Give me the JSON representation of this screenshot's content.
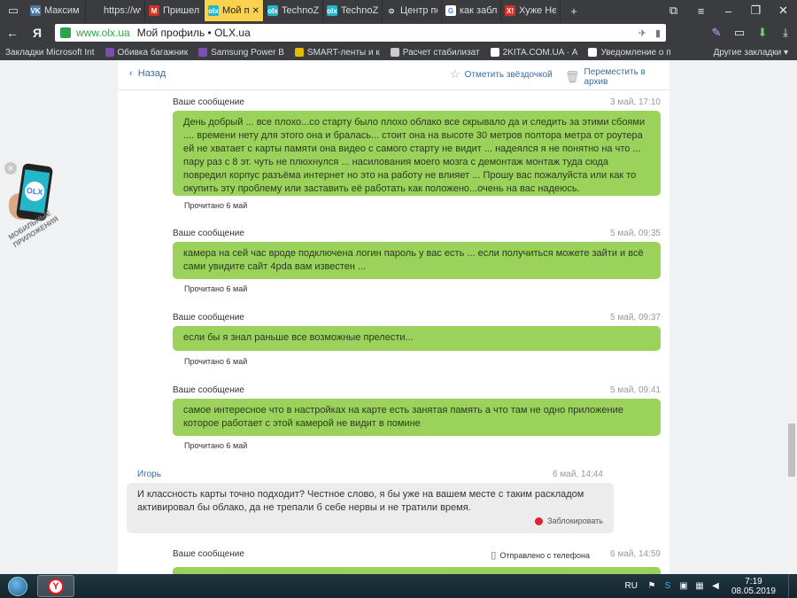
{
  "browser": {
    "tabs": [
      {
        "label": "Максим И",
        "color": "#4a76a8",
        "glyph": "VK"
      },
      {
        "label": "https://ww",
        "color": "",
        "glyph": ""
      },
      {
        "label": "Пришел х",
        "color": "#d93025",
        "glyph": "M"
      },
      {
        "label": "Мой пр",
        "color": "#23b7c9",
        "glyph": "olx",
        "active": true
      },
      {
        "label": "TechnoZo",
        "color": "#23b7c9",
        "glyph": "olx"
      },
      {
        "label": "TechnoZo",
        "color": "#23b7c9",
        "glyph": "olx"
      },
      {
        "label": "Центр пол",
        "color": "",
        "glyph": "⊙"
      },
      {
        "label": "как забло",
        "color": "#ffffff",
        "glyph": "G"
      },
      {
        "label": "Хуже Нет",
        "color": "#d93025",
        "glyph": "X!"
      }
    ],
    "address": {
      "domain": "www.olx.ua",
      "title": "Мой профиль • OLX.ua"
    },
    "bookmarks": [
      {
        "label": "Закладки Microsoft Int",
        "color": ""
      },
      {
        "label": "Обивка багажник",
        "color": "#7b4fb0"
      },
      {
        "label": "Samsung Power B",
        "color": "#7b4fb0"
      },
      {
        "label": "SMART-ленты и к",
        "color": "#e6b800"
      },
      {
        "label": "Расчет стабилизат",
        "color": "#cccccc"
      },
      {
        "label": "2KITA.COM.UA · А",
        "color": "#ffffff"
      },
      {
        "label": "Уведомление о п",
        "color": "#ffffff"
      }
    ],
    "other_bookmarks": "Другие закладки"
  },
  "topbar": {
    "back": "Назад",
    "star": "Отметить звёздочкой",
    "archive": "Переместить в архив"
  },
  "promo": {
    "logo": "OLX",
    "label_line1": "МОБИЛЬНЫЕ",
    "label_line2": "ПРИЛОЖЕНИЯ"
  },
  "messages": [
    {
      "sender": "Ваше сообщение",
      "time": "3 май, 17:10",
      "text": "День добрый ... все плохо...со старту было плохо облако все скрывало да и следить за этими сбоями .... времени нету для этого она и бралась... стоит она на высоте 30 метров полтора метра от роутера ей не хватает с карты памяти она видео с самого старту не видит ... надеялся я не понятно на что ... пару раз с 8 эт. чуть не плюхнулся ... насилования моего мозга с демонтаж монтаж туда сюда повредил корпус разъёма интернет но это на работу не влияет ... Прошу вас пожалуйста или как то окупить эту проблему или заставить её работать как положено...очень на вас надеюсь.",
      "read": "Прочитано 6 май"
    },
    {
      "sender": "Ваше сообщение",
      "time": "5 май, 09:35",
      "text": "камера на сей час вроде подключена логин пароль у вас есть ... если получиться можете зайти и всё сами увидите сайт 4pda вам известен ...",
      "read": "Прочитано 6 май"
    },
    {
      "sender": "Ваше сообщение",
      "time": "5 май, 09:37",
      "text": "если бы я знал раньше все возможные прелести...",
      "read": "Прочитано 6 май"
    },
    {
      "sender": "Ваше сообщение",
      "time": "5 май, 09:41",
      "text": "самое интересное что в настройках на карте есть занятая память а что там не одно приложение которое работает с этой камерой не видит в помине",
      "read": "Прочитано 6 май"
    }
  ],
  "reply": {
    "sender": "Игорь",
    "time": "6 май, 14:44",
    "text": "И классность карты точно подходит? Честное слово, я бы уже на вашем месте с таким раскладом активировал бы облако, да не трепали б себе нервы и не тратили время.",
    "block": "Заблокировать"
  },
  "last": {
    "sender": "Ваше сообщение",
    "sent_from": "Отправлено с телефона",
    "time": "6 май, 14:59"
  },
  "taskbar": {
    "lang": "RU",
    "time": "7:19",
    "date": "08.05.2019"
  }
}
